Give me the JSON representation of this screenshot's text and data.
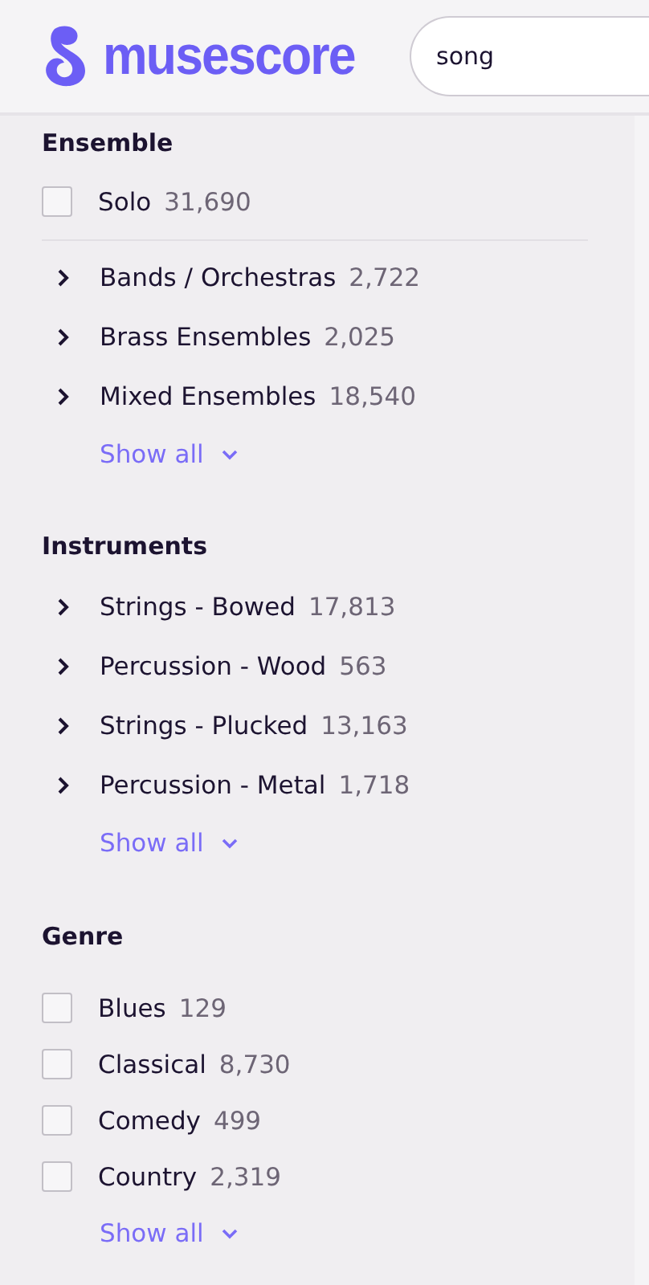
{
  "header": {
    "logo": "musescore",
    "search": {
      "value": "song"
    }
  },
  "sections": [
    {
      "title": "Ensemble",
      "items": [
        {
          "kind": "checkbox",
          "label": "Solo",
          "count": "31,690",
          "checked": false
        },
        {
          "kind": "divider"
        },
        {
          "kind": "expandable",
          "label": "Bands / Orchestras",
          "count": "2,722",
          "expanded": false
        },
        {
          "kind": "expandable",
          "label": "Brass Ensembles",
          "count": "2,025",
          "expanded": false
        },
        {
          "kind": "expandable",
          "label": "Mixed Ensembles",
          "count": "18,540",
          "expanded": false
        }
      ],
      "show_all": "Show all"
    },
    {
      "title": "Instruments",
      "items": [
        {
          "kind": "expandable",
          "label": "Strings - Bowed",
          "count": "17,813",
          "expanded": false
        },
        {
          "kind": "expandable",
          "label": "Percussion - Wood",
          "count": "563",
          "expanded": false
        },
        {
          "kind": "expandable",
          "label": "Strings - Plucked",
          "count": "13,163",
          "expanded": false
        },
        {
          "kind": "expandable",
          "label": "Percussion - Metal",
          "count": "1,718",
          "expanded": false
        }
      ],
      "show_all": "Show all"
    },
    {
      "title": "Genre",
      "items": [
        {
          "kind": "checkbox",
          "label": "Blues",
          "count": "129",
          "checked": false
        },
        {
          "kind": "checkbox",
          "label": "Classical",
          "count": "8,730",
          "checked": false
        },
        {
          "kind": "checkbox",
          "label": "Comedy",
          "count": "499",
          "checked": false
        },
        {
          "kind": "checkbox",
          "label": "Country",
          "count": "2,319",
          "checked": false
        }
      ],
      "show_all": "Show all"
    }
  ]
}
